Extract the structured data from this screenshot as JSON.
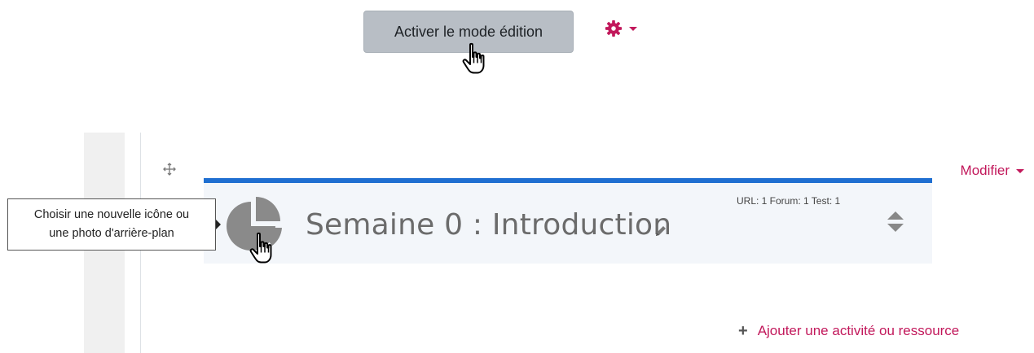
{
  "header": {
    "edit_mode_button": "Activer le mode édition",
    "settings_icon": "gear-icon",
    "accent_color": "#c2185b"
  },
  "section": {
    "modifier_label": "Modifier",
    "title": "Semaine 0 : Introduction",
    "summary": "URL: 1 Forum: 1 Test: 1",
    "icon": "pie-chart-icon",
    "border_color": "#1f6fd1",
    "background_color": "#f3f6fa"
  },
  "tooltip": {
    "line1": "Choisir une nouvelle icône ou",
    "line2": "une photo d'arrière-plan"
  },
  "footer": {
    "add_activity_label": "Ajouter une activité ou ressource"
  }
}
